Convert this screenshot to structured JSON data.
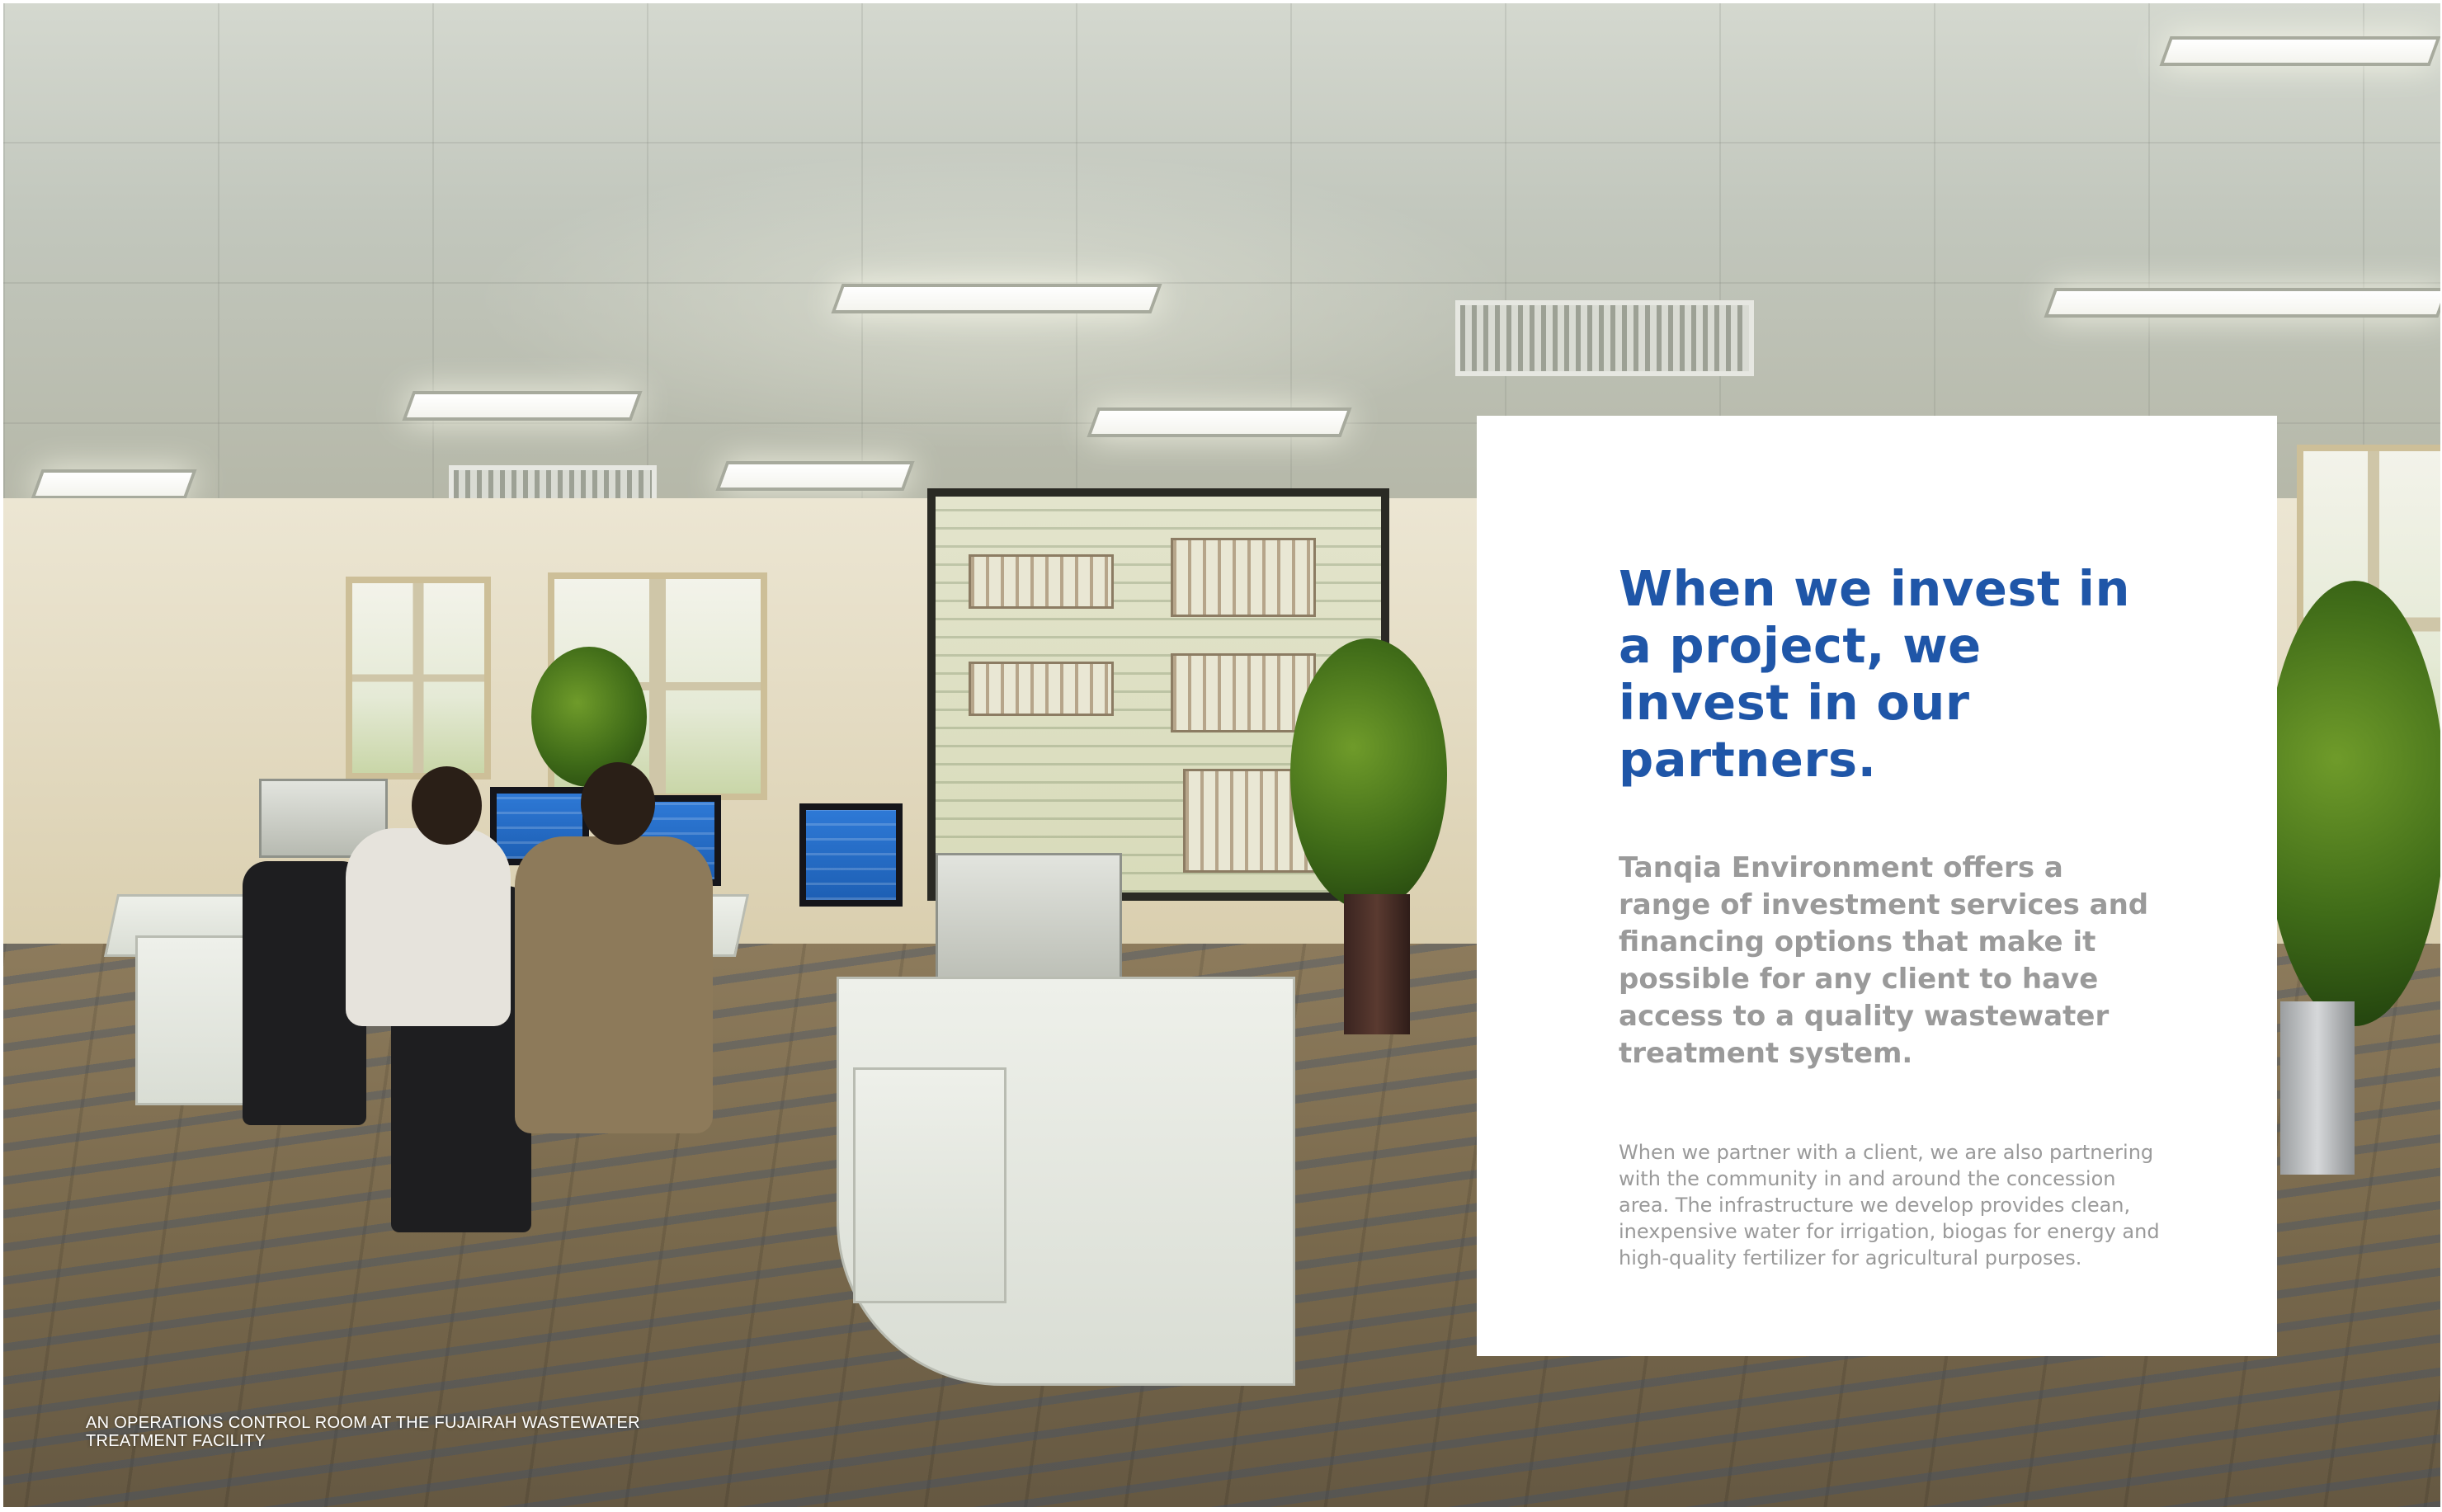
{
  "panel": {
    "headline": "When we invest in a project, we invest in our partners.",
    "lead": "Tanqia Environment offers a range of investment services and financing options that make it possible for any client to have access to a quality wastewater treatment system.",
    "body": "When we partner with a client, we are also partnering with the community in and around the concession area. The infrastructure we develop provides clean, inexpensive water for irrigation, biogas for energy and high-quality fertilizer for agricultural purposes."
  },
  "photo": {
    "caption": "AN OPERATIONS CONTROL ROOM AT THE FUJAIRAH WASTEWATER TREATMENT FACILITY"
  },
  "colors": {
    "headline": "#1f56a8",
    "body": "#9a9a9a",
    "panel_background": "#ffffff"
  }
}
